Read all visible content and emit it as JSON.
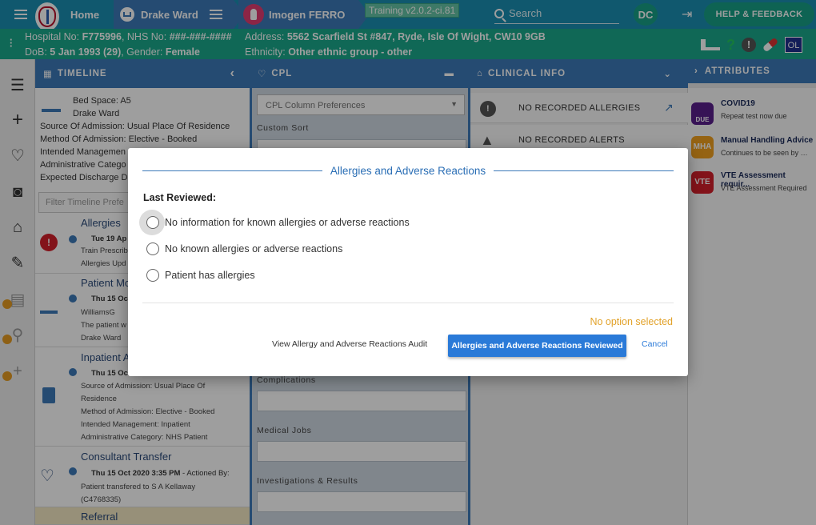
{
  "topbar": {
    "home": "Home",
    "ward": "Drake Ward",
    "patient": "Imogen FERRO",
    "training": "Training v2.0.2-ci.81",
    "search_placeholder": "Search",
    "user_initials": "DC",
    "help": "HELP & FEEDBACK"
  },
  "infobar": {
    "hospital_label": "Hospital No:",
    "hospital_no": "F775996",
    "nhs_label": ", NHS No:",
    "nhs_no": "###-###-####",
    "dob_label": "DoB:",
    "dob": "5 Jan 1993 (29)",
    "gender_label": ", Gender:",
    "gender": "Female",
    "address_label": "Address:",
    "address": "5562 Scarfield St #847, Ryde, Isle Of Wight, CW10 9GB",
    "ethnicity_label": "Ethnicity:",
    "ethnicity": "Other ethnic group - other",
    "ol_badge": "OL"
  },
  "columns": {
    "timeline": "TIMELINE",
    "cpl": "CPL",
    "clinical": "CLINICAL INFO",
    "attributes": "ATTRIBUTES"
  },
  "timeline": {
    "bed_space": "Bed Space: A5",
    "ward": "Drake Ward",
    "source": "Source Of Admission: Usual Place Of Residence",
    "method": "Method Of Admission: Elective - Booked",
    "intended": "Intended Managemen",
    "admin": "Administrative Catego",
    "expected": "Expected Discharge Da",
    "filter_placeholder": "Filter Timeline Prefe",
    "items": [
      {
        "title": "Allergies",
        "date": "Tue 19 Ap",
        "l1": "Train Prescrib",
        "l2": "Allergies Upd"
      },
      {
        "title": "Patient Mo",
        "date": "Thu 15 Oc",
        "l1": "WilliamsG",
        "l2": "The patient w",
        "l3": "Drake Ward"
      },
      {
        "title": "Inpatient A",
        "date": "Thu 15 Oc",
        "l1": "Source of Admission: Usual Place Of",
        "l2": "Residence",
        "l3": "Method of Admission: Elective - Booked",
        "l4": "Intended Management: Inpatient",
        "l5": "Administrative Category: NHS Patient"
      },
      {
        "title": "Consultant Transfer",
        "date": "Thu 15 Oct 2020 3:35 PM",
        "date_suffix": " - Actioned By:",
        "l1": "Patient transfered to S A Kellaway",
        "l2": "(C4768335)"
      },
      {
        "title": "Referral"
      }
    ]
  },
  "cpl": {
    "select": "CPL Column Preferences",
    "custom_sort": "Custom Sort",
    "complications": "Complications",
    "medical_jobs": "Medical Jobs",
    "investigations": "Investigations & Results"
  },
  "clinical": {
    "allergies": "NO RECORDED ALLERGIES",
    "alerts": "NO RECORDED ALERTS"
  },
  "attributes": [
    {
      "badge": "DUE",
      "name": "COVID19",
      "desc": "Repeat test now due",
      "color": "#5a1f8c"
    },
    {
      "badge": "MHA",
      "name": "Manual Handling Advice",
      "desc": "Continues to be seen by M...",
      "color": "#f0a020"
    },
    {
      "badge": "VTE",
      "name": "VTE Assessment requir...",
      "desc": "VTE Assessment Required",
      "color": "#d31f2a"
    }
  ],
  "modal": {
    "title": "Allergies and Adverse Reactions",
    "last_reviewed": "Last Reviewed:",
    "options": [
      "No information for known allergies or adverse reactions",
      "No known allergies or adverse reactions",
      "Patient has allergies"
    ],
    "status": "No option selected",
    "audit": "View Allergy and Adverse Reactions Audit",
    "reviewed": "Allergies and Adverse Reactions Reviewed",
    "cancel": "Cancel"
  },
  "colors": {
    "primary": "#3c79b8",
    "topbar": "#1b8fb2",
    "infobar": "#1aa88c",
    "accent_button": "#2a7ad8",
    "warning_text": "#e2a22a"
  }
}
